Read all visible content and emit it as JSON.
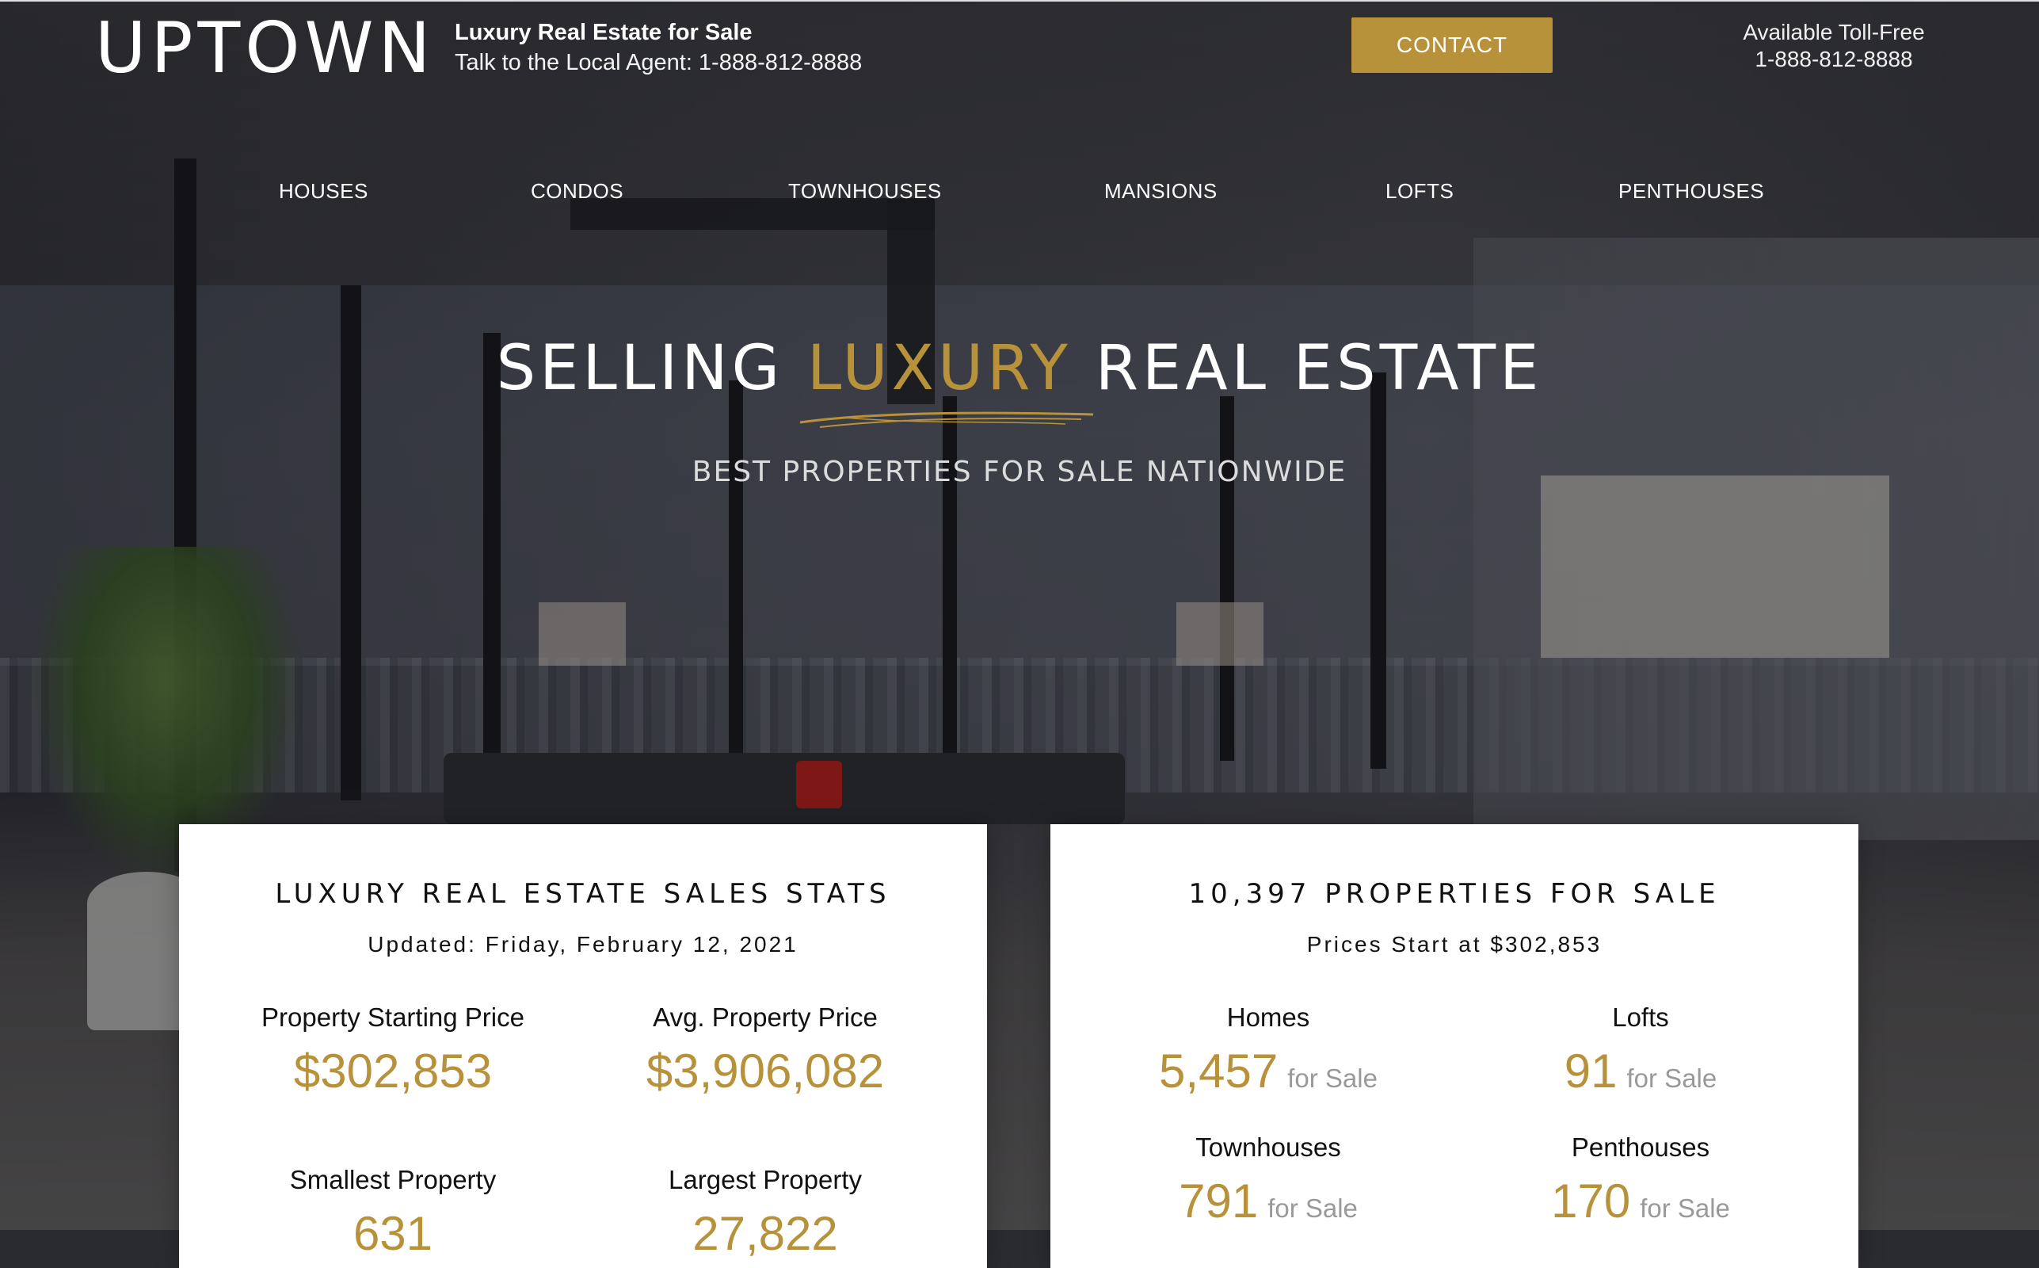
{
  "header": {
    "logo": "UPTOWN",
    "tagline_title": "Luxury Real Estate for Sale",
    "tagline_sub": "Talk to the Local Agent: 1-888-812-8888",
    "contact_label": "CONTACT",
    "tollfree_label": "Available Toll-Free",
    "tollfree_number": "1-888-812-8888"
  },
  "nav": {
    "items": [
      "HOUSES",
      "CONDOS",
      "TOWNHOUSES",
      "MANSIONS",
      "LOFTS",
      "PENTHOUSES"
    ]
  },
  "hero": {
    "headline_part1": "SELLING",
    "headline_gold": "LUXURY",
    "headline_part2": "REAL ESTATE",
    "subheadline": "BEST PROPERTIES FOR SALE NATIONWIDE"
  },
  "stats_card": {
    "title": "LUXURY REAL ESTATE SALES STATS",
    "updated": "Updated: Friday, February 12, 2021",
    "items": [
      {
        "label": "Property Starting Price",
        "value": "$302,853"
      },
      {
        "label": "Avg. Property Price",
        "value": "$3,906,082"
      },
      {
        "label": "Smallest Property",
        "value": "631"
      },
      {
        "label": "Largest Property",
        "value": "27,822"
      }
    ]
  },
  "properties_card": {
    "title": "10,397 PROPERTIES FOR SALE",
    "subtitle": "Prices Start at $302,853",
    "items": [
      {
        "label": "Homes",
        "value": "5,457",
        "suffix": "for Sale"
      },
      {
        "label": "Lofts",
        "value": "91",
        "suffix": "for Sale"
      },
      {
        "label": "Townhouses",
        "value": "791",
        "suffix": "for Sale"
      },
      {
        "label": "Penthouses",
        "value": "170",
        "suffix": "for Sale"
      }
    ]
  },
  "colors": {
    "accent_gold": "#b8923b",
    "card_background": "#ffffff",
    "muted_text": "#999999"
  }
}
